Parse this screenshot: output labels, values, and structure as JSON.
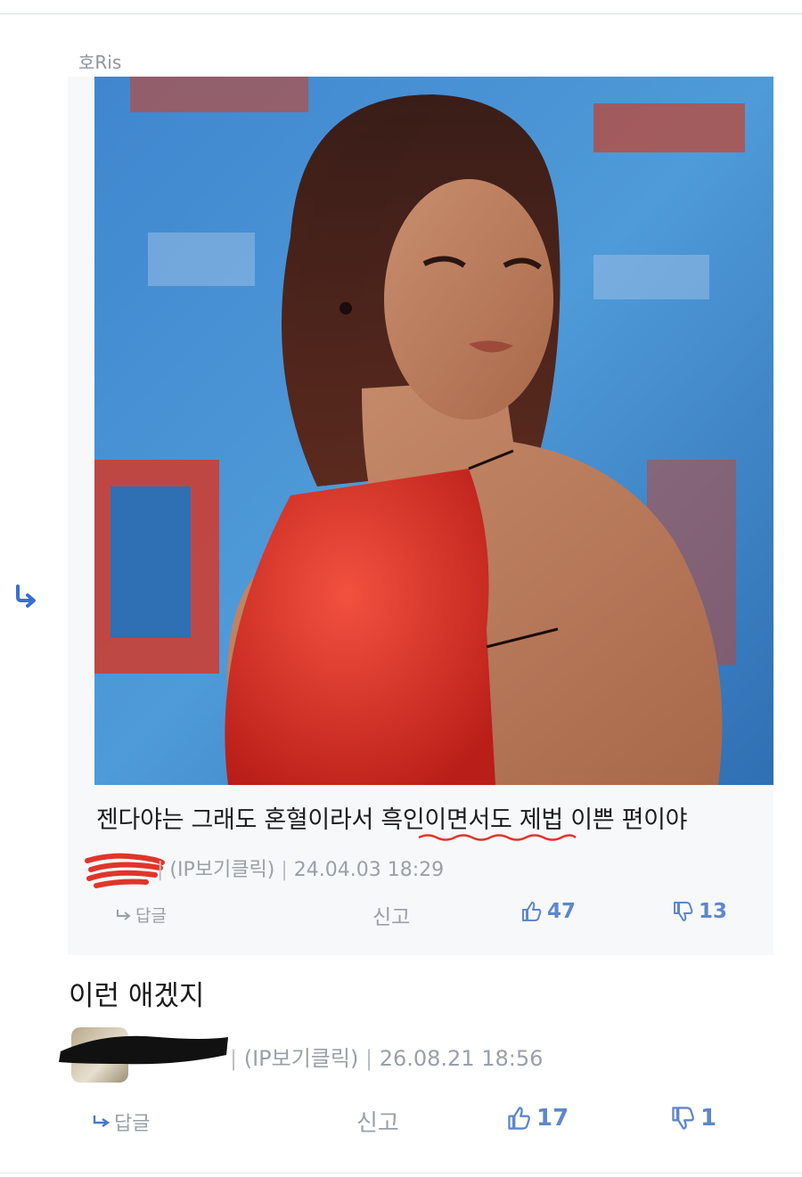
{
  "quoted_comment": {
    "author": "호Ris",
    "text": "젠다야는 그래도 혼혈이라서 흑인이면서도 제법 이쁜 편이야",
    "ip_label": "(IP보기클릭)",
    "timestamp": "24.04.03 18:29",
    "reply_label": "답글",
    "report_label": "신고",
    "upvotes": "47",
    "downvotes": "13"
  },
  "comment": {
    "text": "이런 애겠지",
    "ip_label": "(IP보기클릭)",
    "timestamp": "26.08.21 18:56",
    "reply_label": "답글",
    "report_label": "신고",
    "upvotes": "17",
    "downvotes": "1"
  },
  "icons": {
    "reply_arrow": "reply-arrow-icon",
    "thumbs_up": "thumbs-up-icon",
    "thumbs_down": "thumbs-down-icon"
  },
  "colors": {
    "accent": "#3a6fd1",
    "vote": "#5f87c9",
    "muted": "#9aa0a8",
    "scribble_red": "#e0352b"
  }
}
